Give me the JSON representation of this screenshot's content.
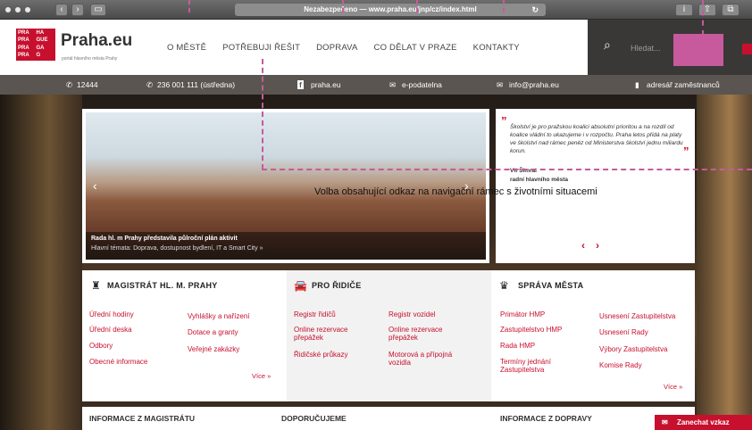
{
  "browser": {
    "url": "Nezabezpečeno — www.praha.eu/jnp/cz/index.html",
    "reload_icon": "↻"
  },
  "header": {
    "logo_cells": [
      "PRA",
      "HA",
      "PRA",
      "GUE",
      "PRA",
      "GA",
      "PRA",
      "G"
    ],
    "brand": "Praha.eu",
    "brand_sub": "portál hlavního města Prahy",
    "nav": [
      "O MĚSTĚ",
      "POTŘEBUJI ŘEŠIT",
      "DOPRAVA",
      "CO DĚLAT V PRAZE",
      "KONTAKTY"
    ],
    "search_placeholder": "Hledat..."
  },
  "contactbar": {
    "phone1": "12444",
    "phone2": "236 001 111 (ústředna)",
    "facebook": "praha.eu",
    "epodatelna": "e-podatelna",
    "email": "info@praha.eu",
    "adresar": "adresář zaměstnanců"
  },
  "slider": {
    "title": "Rada hl. m Prahy představila půlroční plán aktivit",
    "subtitle": "Hlavní témata: Doprava, dostupnost bydlení, IT a Smart City »"
  },
  "quote": {
    "text": "Školství je pro pražskou koalici absolutní prioritou a na rozdíl od koalice vládní to ukazujeme i v rozpočtu. Praha letos přidá na platy ve školství nad rámec peněz od Ministerstva školství jednu miliardu korun.",
    "author": "Vít Šimral",
    "role": "radní hlavního města"
  },
  "annotation": "Volba obsahující odkaz na navigační rámec s životními situacemi",
  "columns": {
    "magistrat": {
      "title": "MAGISTRÁT HL. M. PRAHY",
      "left": [
        "Úřední hodiny",
        "Úřední deska",
        "Odbory",
        "Obecné informace"
      ],
      "right": [
        "Vyhlášky a nařízení",
        "Dotace a granty",
        "Veřejné zakázky"
      ],
      "more": "Více »"
    },
    "ridice": {
      "title": "PRO ŘIDIČE",
      "left": [
        "Registr řidičů",
        "Online rezervace přepážek",
        "Řidičské průkazy"
      ],
      "right": [
        "Registr vozidel",
        "Online rezervace přepážek",
        "Motorová a přípojná vozidla"
      ]
    },
    "sprava": {
      "title": "SPRÁVA MĚSTA",
      "left": [
        "Primátor HMP",
        "Zastupitelstvo HMP",
        "Rada HMP",
        "Termíny jednání Zastupitelstva"
      ],
      "right": [
        "Usnesení Zastupitelstva",
        "Usnesení Rady",
        "Výbory Zastupitelstva",
        "Komise Rady"
      ],
      "more": "Více »"
    }
  },
  "bottom": {
    "h1": "INFORMACE Z MAGISTRÁTU",
    "h2": "DOPORUČUJEME",
    "h3": "INFORMACE Z DOPRAVY",
    "feedback": "Zanechat vzkaz"
  }
}
